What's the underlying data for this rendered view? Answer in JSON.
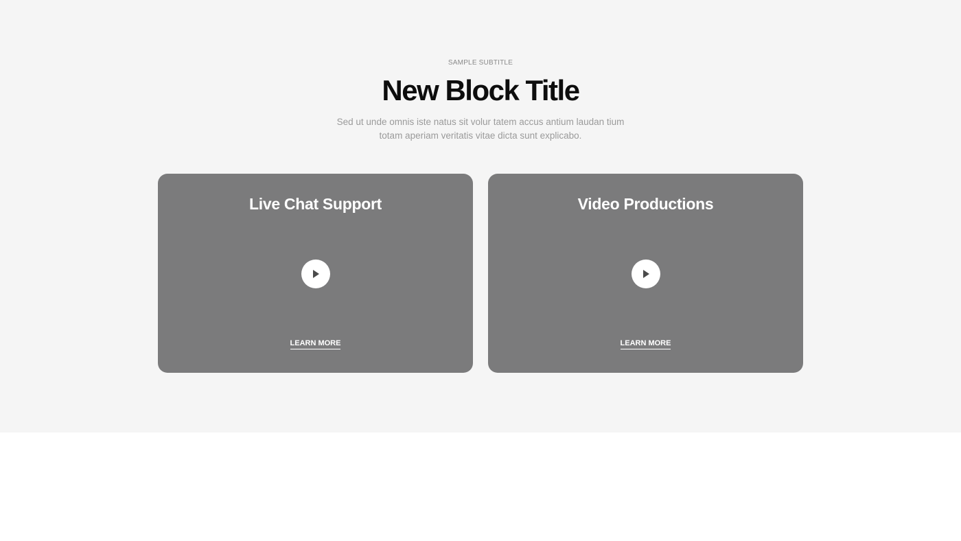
{
  "header": {
    "subtitle": "SAMPLE SUBTITLE",
    "title": "New Block Title",
    "description_line1": "Sed ut unde omnis iste natus sit volur tatem accus antium laudan tium",
    "description_line2": "totam aperiam veritatis vitae dicta sunt explicabo."
  },
  "cards": [
    {
      "title": "Live Chat Support",
      "icon": "play-icon",
      "link_label": "LEARN MORE"
    },
    {
      "title": "Video Productions",
      "icon": "play-icon",
      "link_label": "LEARN MORE"
    }
  ],
  "colors": {
    "section_bg": "#f5f5f5",
    "card_bg": "#7b7b7c",
    "title": "#0d0d0d",
    "muted_text": "#9a9a9a"
  }
}
